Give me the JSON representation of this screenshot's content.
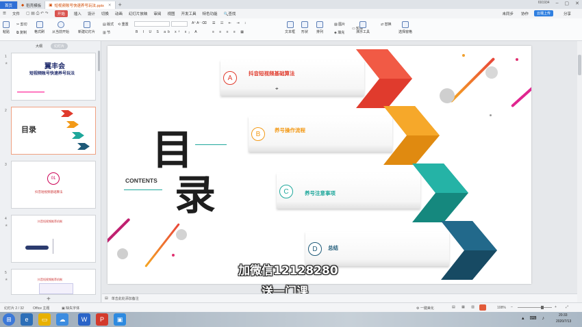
{
  "titlebar": {
    "home": "首页",
    "tab1": "稻壳模板",
    "tab2": "短视频账号快速养号玩法.pptx",
    "user": "691934"
  },
  "menu": {
    "file": "文件",
    "start": "开始",
    "items": [
      "插入",
      "设计",
      "切换",
      "动画",
      "幻灯片放映",
      "审阅",
      "视图",
      "开发工具",
      "特色功能"
    ],
    "search": "查找",
    "cloud": "未同步",
    "cloud2": "协作",
    "share": "分享",
    "upload": "云端上传"
  },
  "ribbon": {
    "paste": "粘贴",
    "cut": "剪切",
    "copy": "复制",
    "format_painter": "格式刷",
    "from_current": "从当前开始",
    "new_slide": "新建幻灯片",
    "layout": "版式",
    "section": "节",
    "reset": "重置",
    "textbox": "文本框",
    "shape": "形状",
    "arrange": "排列",
    "picture": "图片",
    "fill": "填充",
    "outline": "轮廓",
    "presenter": "演示工具",
    "replace": "替换",
    "select": "选择窗格"
  },
  "panel": {
    "tab_outline": "大纲",
    "tab_slides": "幻灯片",
    "thumbs": [
      {
        "num": "1",
        "title": "翼丰会",
        "subtitle": "短视频账号快速养号玩法"
      },
      {
        "num": "2",
        "title": "目录"
      },
      {
        "num": "3",
        "badge": "01",
        "caption": "抖音短视频基础算法"
      },
      {
        "num": "4",
        "caption": "抖音短视频推荐机制"
      },
      {
        "num": "5",
        "caption": "抖音短视频推荐机制"
      }
    ]
  },
  "slide": {
    "title_char1": "目",
    "title_char2": "录",
    "contents": "CONTENTS",
    "items": [
      {
        "letter": "A",
        "text": "抖音短视频基础算法",
        "color": "#e03b2d"
      },
      {
        "letter": "B",
        "text": "养号操作流程",
        "color": "#f39a18"
      },
      {
        "letter": "C",
        "text": "养号注意事项",
        "color": "#1ea79b"
      },
      {
        "letter": "D",
        "text": "总结",
        "color": "#1e5a78"
      }
    ]
  },
  "overlay": {
    "line1": "加微信12128280",
    "line2": "送一门课"
  },
  "notes": {
    "placeholder": "单击此处添加备注"
  },
  "status": {
    "slide": "幻灯片 2 / 32",
    "theme": "Office 主题",
    "font": "缺失字体",
    "smooth": "一键美化",
    "zoom": "108%",
    "time": "20:33",
    "date": "2020/7/13"
  }
}
